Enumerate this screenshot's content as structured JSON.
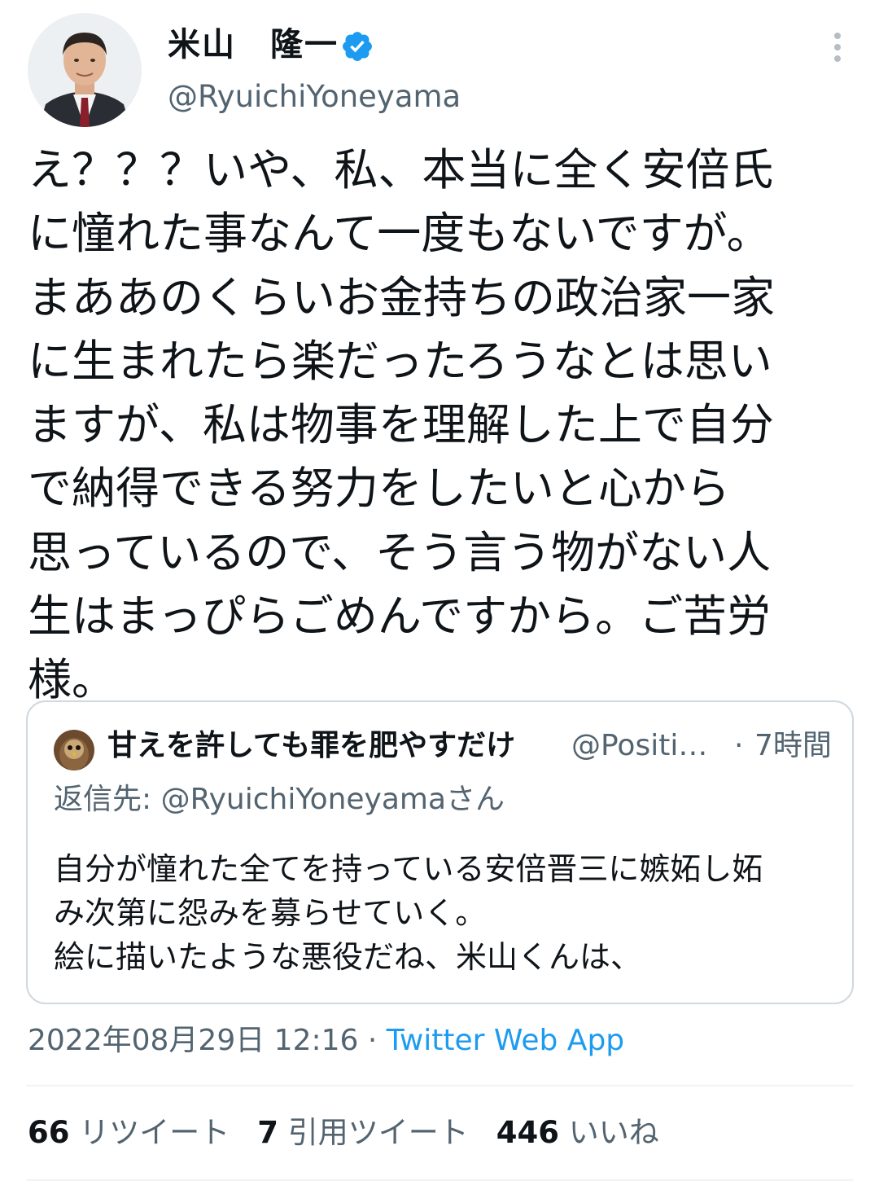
{
  "author": {
    "display_name": "米山　隆一",
    "handle": "@RyuichiYoneyama",
    "verified_icon": "verified-badge-icon",
    "verified_color": "#1d9bf0"
  },
  "tweet": {
    "text_lines": [
      "え？？？いや、私、本当に全く安倍氏",
      "に憧れた事なんて一度もないですが。",
      "まああのくらいお金持ちの政治家一家",
      "に生まれたら楽だったろうなとは思い",
      "ますが、私は物事を理解した上で自分",
      "で納得できる努力をしたいと心から",
      "思っているので、そう言う物がない人",
      "生はまっぴらごめんですから。ご苦労",
      "様。"
    ]
  },
  "quoted": {
    "display_name": "甘えを許しても罪を肥やすだけ",
    "handle": "@Positi…",
    "separator": "·",
    "time": "7時間",
    "reply_label": "返信先: ",
    "reply_to": "@RyuichiYoneyamaさん",
    "text_lines": [
      "自分が憧れた全てを持っている安倍晋三に嫉妬し妬",
      "み次第に怨みを募らせていく。",
      "絵に描いたような悪役だね、米山くんは、"
    ]
  },
  "meta": {
    "timestamp": "2022年08月29日 12:16",
    "separator": " · ",
    "source": "Twitter Web App",
    "source_color": "#1d9bf0"
  },
  "stats": {
    "retweets_count": "66",
    "retweets_label": "リツイート",
    "quotes_count": "7",
    "quotes_label": "引用ツイート",
    "likes_count": "446",
    "likes_label": "いいね"
  },
  "icons": {
    "more": "more-options-icon"
  }
}
